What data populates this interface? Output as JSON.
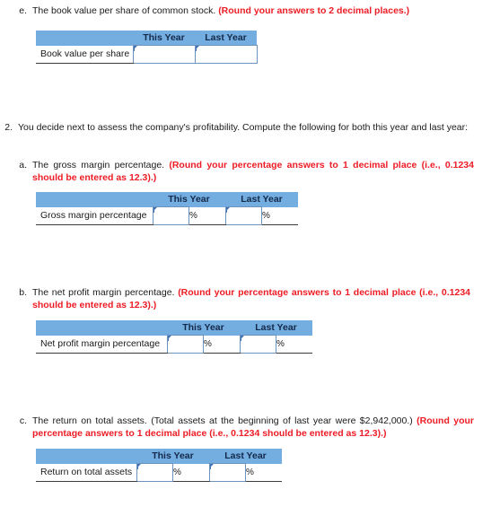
{
  "colors": {
    "header_blue": "#74aee0",
    "note_red": "#ee1c25",
    "input_border": "#6c92bd",
    "rule": "#3c3c3c"
  },
  "common": {
    "col_this_year": "This Year",
    "col_last_year": "Last Year",
    "percent_symbol": "%",
    "answer_value": "",
    "answer_placeholder": ""
  },
  "part_e": {
    "marker": "e.",
    "text": "The book value per share of common stock. ",
    "note": "(Round your answers to 2 decimal places.)",
    "table": {
      "headers": [
        "",
        "This Year",
        "Last Year"
      ],
      "row_label": "Book value per share",
      "has_percent": false
    }
  },
  "question_2": {
    "marker": "2.",
    "text": "You decide next to assess the company's profitability. Compute the following for both this year and last year:",
    "parts": [
      {
        "marker": "a.",
        "text": "The gross margin percentage. ",
        "note": "(Round your percentage answers to 1 decimal place (i.e., 0.1234 should be entered as 12.3).)",
        "table": {
          "headers": [
            "",
            "This Year",
            "Last Year"
          ],
          "row_label": "Gross margin percentage",
          "has_percent": true
        }
      },
      {
        "marker": "b.",
        "text": "The net profit margin percentage. ",
        "note": "(Round your percentage answers to 1 decimal place (i.e., 0.1234 should be entered as 12.3).)",
        "table": {
          "headers": [
            "",
            "This Year",
            "Last Year"
          ],
          "row_label": "Net profit margin percentage",
          "has_percent": true
        }
      },
      {
        "marker": "c.",
        "text": "The return on total assets. (Total assets at the beginning of last year were $2,942,000.) ",
        "note": "(Round your percentage answers to 1 decimal place (i.e., 0.1234 should be entered as 12.3).)",
        "table": {
          "headers": [
            "",
            "This Year",
            "Last Year"
          ],
          "row_label": "Return on total assets",
          "has_percent": true
        }
      }
    ]
  }
}
